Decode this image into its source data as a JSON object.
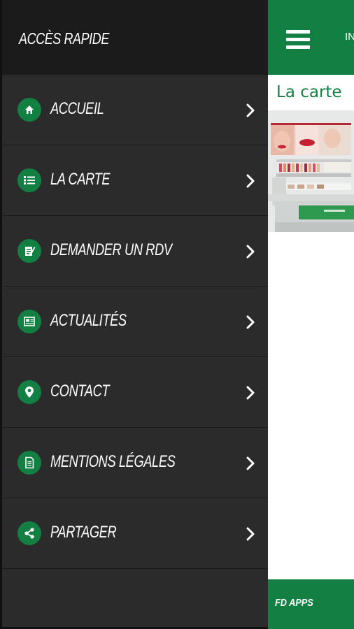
{
  "drawer": {
    "title": "ACCÈS RAPIDE",
    "items": [
      {
        "label": "ACCUEIL",
        "icon": "home-icon"
      },
      {
        "label": "LA CARTE",
        "icon": "list-icon"
      },
      {
        "label": "DEMANDER UN RDV",
        "icon": "edit-form-icon"
      },
      {
        "label": "ACTUALITÉS",
        "icon": "news-icon"
      },
      {
        "label": "CONTACT",
        "icon": "location-pin-icon"
      },
      {
        "label": "MENTIONS LÉGALES",
        "icon": "document-icon"
      },
      {
        "label": "PARTAGER",
        "icon": "share-icon"
      }
    ]
  },
  "main": {
    "header_title": "IN",
    "subtitle": "La carte",
    "footer": "FD APPS"
  },
  "colors": {
    "brand_green": "#138043",
    "drawer_bg": "#2b2b2b",
    "drawer_header_bg": "#1b1b1b"
  }
}
